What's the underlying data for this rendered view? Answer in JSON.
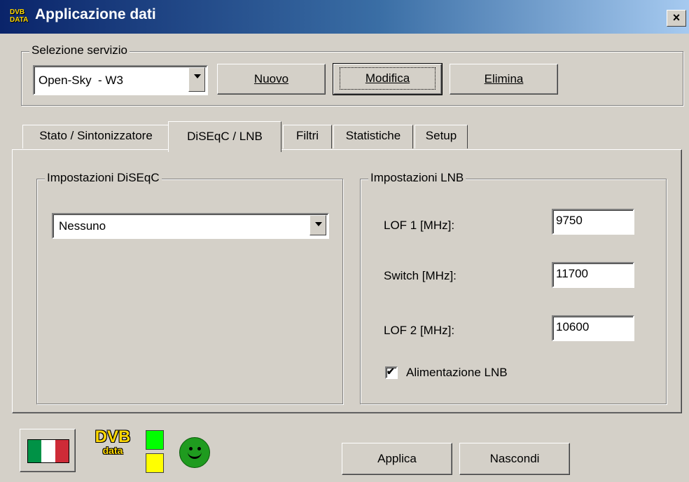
{
  "window": {
    "title": "Applicazione dati",
    "icon_text": "DVB DATA",
    "close_glyph": "×"
  },
  "service": {
    "group_label": "Selezione servizio",
    "selected": "Open-Sky  - W3",
    "new_button": "Nuovo",
    "edit_button": "Modifica",
    "delete_button": "Elimina"
  },
  "tabs": [
    {
      "label": "Stato / Sintonizzatore"
    },
    {
      "label": "DiSEqC / LNB"
    },
    {
      "label": "Filtri"
    },
    {
      "label": "Statistiche"
    },
    {
      "label": "Setup"
    }
  ],
  "active_tab": "DiSEqC / LNB",
  "diseqc": {
    "group_label": "Impostazioni DiSEqC",
    "selected": "Nessuno"
  },
  "lnb": {
    "group_label": "Impostazioni LNB",
    "lof1_label": "LOF 1 [MHz]:",
    "lof1_value": "9750",
    "switch_label": "Switch [MHz]:",
    "switch_value": "11700",
    "lof2_label": "LOF 2 [MHz]:",
    "lof2_value": "10600",
    "power_label": "Alimentazione LNB",
    "power_checked": true,
    "check_glyph": "✔"
  },
  "footer": {
    "logo_top": "DVB",
    "logo_bottom": "data",
    "smiley_glyph": "☺",
    "apply_button": "Applica",
    "hide_button": "Nascondi"
  },
  "colors": {
    "title_start": "#0a246a",
    "title_end": "#a6caf0",
    "led_green": "#00ff00",
    "led_yellow": "#ffff00",
    "smiley": "#1f9b1f",
    "logo": "#ffd800"
  }
}
